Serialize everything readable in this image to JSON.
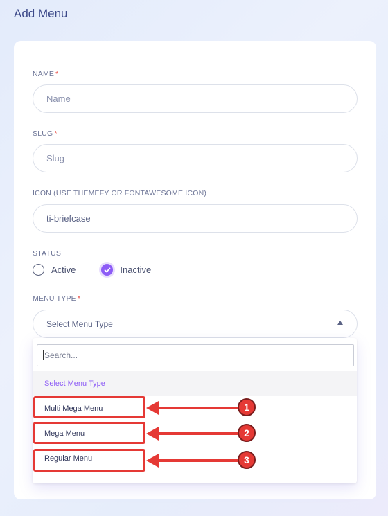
{
  "page": {
    "title": "Add Menu"
  },
  "form": {
    "name": {
      "label": "NAME",
      "required": "*",
      "placeholder": "Name"
    },
    "slug": {
      "label": "SLUG",
      "required": "*",
      "placeholder": "Slug"
    },
    "icon": {
      "label": "ICON (USE THEMEFY OR FONTAWESOME ICON)",
      "value": "ti-briefcase"
    },
    "status": {
      "label": "STATUS",
      "options": [
        {
          "label": "Active",
          "checked": false
        },
        {
          "label": "Inactive",
          "checked": true
        }
      ]
    },
    "menu_type": {
      "label": "MENU TYPE",
      "required": "*",
      "selected": "Select Menu Type",
      "dropdown": {
        "search_placeholder": "Search...",
        "options": [
          {
            "label": "Select Menu Type"
          },
          {
            "label": "Multi Mega Menu"
          },
          {
            "label": "Mega Menu"
          },
          {
            "label": "Regular Menu"
          }
        ]
      }
    }
  },
  "annotations": {
    "badges": [
      "1",
      "2",
      "3"
    ]
  },
  "colors": {
    "accent": "#8d5cf6",
    "annotation": "#e53935",
    "title": "#3d4a8a"
  }
}
